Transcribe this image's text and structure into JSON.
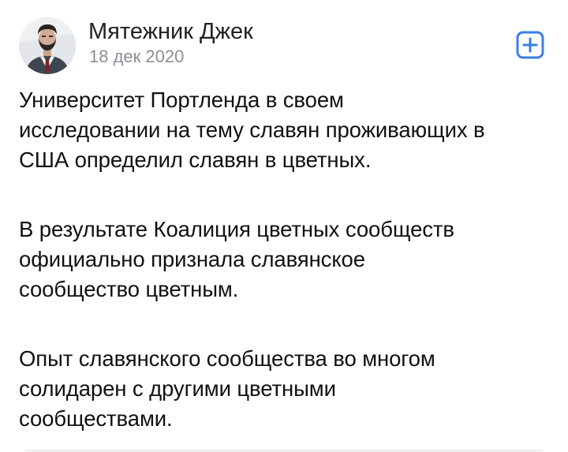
{
  "author": {
    "name": "Мятежник Джек",
    "date": "18 дек 2020"
  },
  "icons": {
    "add": "add-square-icon",
    "avatar": "user-avatar"
  },
  "colors": {
    "accent": "#3a7de8",
    "name_text": "#222222",
    "date_text": "#8a8f96"
  },
  "post": {
    "paragraphs": [
      {
        "lines": [
          "Университет Портленда в своем",
          "исследовании на тему славян проживающих в",
          "США определил славян в цветных."
        ]
      },
      {
        "lines": [
          "В результате Коалиция цветных сообществ",
          "официально признала славянское",
          "сообщество цветным."
        ]
      },
      {
        "lines": [
          "Опыт славянского сообщества во многом",
          "солидарен с другими цветными",
          "сообществами."
        ]
      }
    ]
  }
}
